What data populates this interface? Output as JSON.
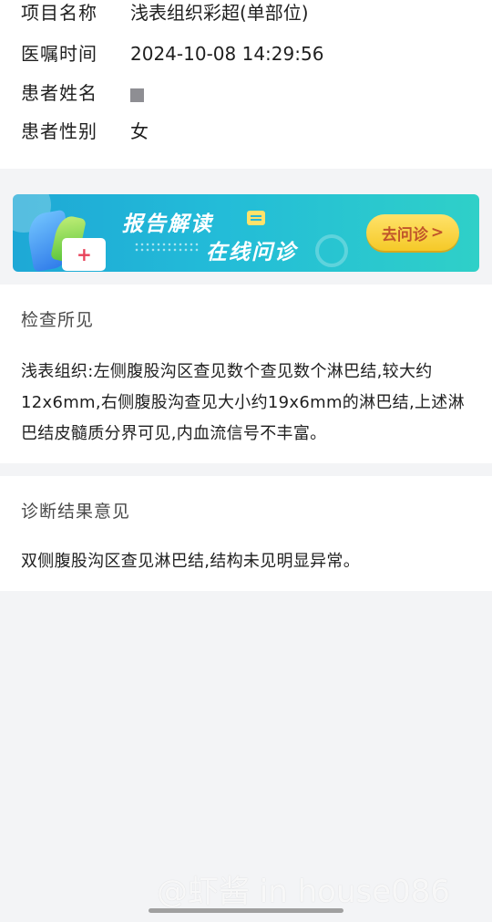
{
  "info": {
    "rows": [
      {
        "label": "项目名称",
        "value": "浅表组织彩超(单部位)"
      },
      {
        "label": "医嘱时间",
        "value": "2024-10-08 14:29:56"
      },
      {
        "label": "患者姓名",
        "value": ""
      },
      {
        "label": "患者性别",
        "value": "女"
      }
    ]
  },
  "banner": {
    "title": "报告解读",
    "subtitle": "在线问诊",
    "button_label": "去问诊",
    "button_chevron": ">"
  },
  "findings": {
    "title": "检查所见",
    "body": "浅表组织:左侧腹股沟区查见数个查见数个淋巴结,较大约12x6mm,右侧腹股沟查见大小约19x6mm的淋巴结,上述淋巴结皮髓质分界可见,内血流信号不丰富。"
  },
  "diagnosis": {
    "title": "诊断结果意见",
    "body": "双侧腹股沟区查见淋巴结,结构未见明显异常。"
  },
  "watermark": "@虾酱 in house086",
  "colors": {
    "banner_start": "#1ea8d6",
    "banner_end": "#2fd0c8",
    "button": "#f5c928",
    "button_text": "#c0552a",
    "background": "#f3f4f6"
  }
}
